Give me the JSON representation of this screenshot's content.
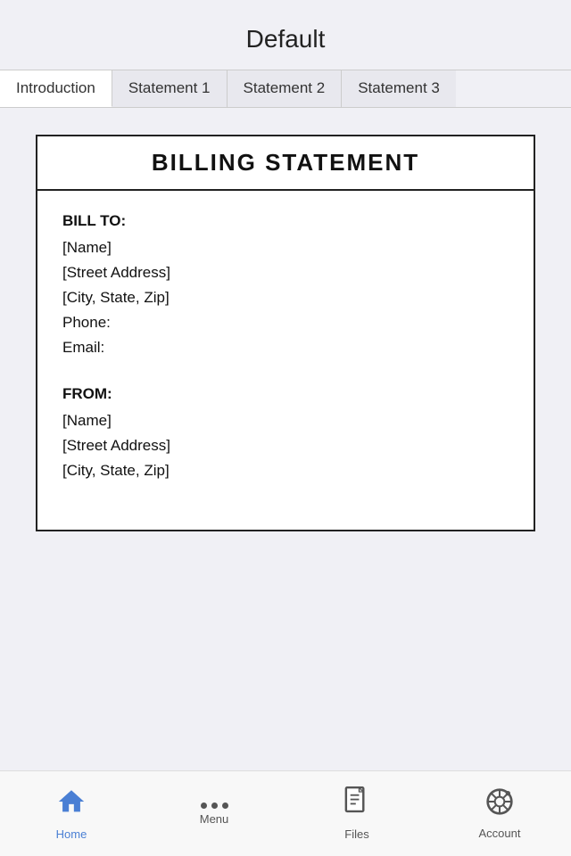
{
  "header": {
    "title": "Default"
  },
  "tabs": [
    {
      "id": "introduction",
      "label": "Introduction",
      "active": true
    },
    {
      "id": "statement1",
      "label": "Statement 1",
      "active": false
    },
    {
      "id": "statement2",
      "label": "Statement 2",
      "active": false
    },
    {
      "id": "statement3",
      "label": "Statement 3",
      "active": false
    }
  ],
  "billing": {
    "title": "BILLING STATEMENT",
    "bill_to_label": "BILL TO:",
    "bill_to_name": "[Name]",
    "bill_to_street": "[Street Address]",
    "bill_to_city": "[City, State, Zip]",
    "bill_to_phone": "Phone:",
    "bill_to_email": "Email:",
    "from_label": "FROM:",
    "from_name": "[Name]",
    "from_street": "[Street Address]",
    "from_city": "[City, State, Zip]"
  },
  "bottom_nav": {
    "home_label": "Home",
    "menu_label": "Menu",
    "files_label": "Files",
    "account_label": "Account"
  }
}
